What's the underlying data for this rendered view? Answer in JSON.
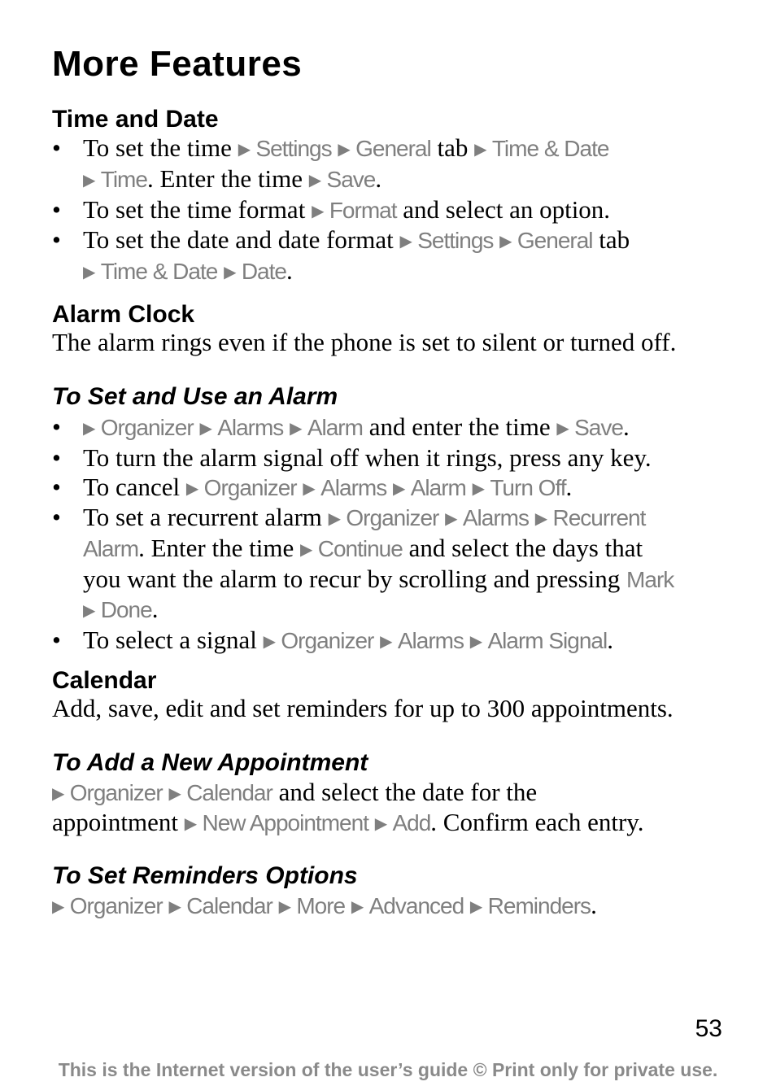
{
  "title": "More Features",
  "sections": {
    "time_date": {
      "heading": "Time and Date",
      "bullets": [
        [
          {
            "t": "text",
            "v": "To set the time "
          },
          {
            "t": "arrow"
          },
          {
            "t": "menu",
            "v": "Settings"
          },
          {
            "t": "text",
            "v": " "
          },
          {
            "t": "arrow"
          },
          {
            "t": "menu",
            "v": "General"
          },
          {
            "t": "text",
            "v": " tab "
          },
          {
            "t": "arrow"
          },
          {
            "t": "menu",
            "v": "Time & Date"
          },
          {
            "t": "br"
          },
          {
            "t": "arrow"
          },
          {
            "t": "menu",
            "v": "Time"
          },
          {
            "t": "text",
            "v": ". Enter the time "
          },
          {
            "t": "arrow"
          },
          {
            "t": "menu",
            "v": "Save"
          },
          {
            "t": "text",
            "v": "."
          }
        ],
        [
          {
            "t": "text",
            "v": "To set the time format "
          },
          {
            "t": "arrow"
          },
          {
            "t": "menu",
            "v": "Format"
          },
          {
            "t": "text",
            "v": " and select an option."
          }
        ],
        [
          {
            "t": "text",
            "v": "To set the date and date format "
          },
          {
            "t": "arrow"
          },
          {
            "t": "menu",
            "v": "Settings"
          },
          {
            "t": "text",
            "v": " "
          },
          {
            "t": "arrow"
          },
          {
            "t": "menu",
            "v": "General"
          },
          {
            "t": "text",
            "v": " tab"
          },
          {
            "t": "br"
          },
          {
            "t": "arrow"
          },
          {
            "t": "menu",
            "v": "Time & Date"
          },
          {
            "t": "text",
            "v": " "
          },
          {
            "t": "arrow"
          },
          {
            "t": "menu",
            "v": "Date"
          },
          {
            "t": "text",
            "v": "."
          }
        ]
      ]
    },
    "alarm_clock": {
      "heading": "Alarm Clock",
      "intro": "The alarm rings even if the phone is set to silent or turned off.",
      "subheading": "To Set and Use an Alarm",
      "bullets": [
        [
          {
            "t": "arrow"
          },
          {
            "t": "menu",
            "v": "Organizer"
          },
          {
            "t": "text",
            "v": " "
          },
          {
            "t": "arrow"
          },
          {
            "t": "menu",
            "v": "Alarms"
          },
          {
            "t": "text",
            "v": " "
          },
          {
            "t": "arrow"
          },
          {
            "t": "menu",
            "v": "Alarm"
          },
          {
            "t": "text",
            "v": " and enter the time "
          },
          {
            "t": "arrow"
          },
          {
            "t": "menu",
            "v": "Save"
          },
          {
            "t": "text",
            "v": "."
          }
        ],
        [
          {
            "t": "text",
            "v": "To turn the alarm signal off when it rings, press any key."
          }
        ],
        [
          {
            "t": "text",
            "v": "To cancel "
          },
          {
            "t": "arrow"
          },
          {
            "t": "menu",
            "v": "Organizer"
          },
          {
            "t": "text",
            "v": " "
          },
          {
            "t": "arrow"
          },
          {
            "t": "menu",
            "v": "Alarms"
          },
          {
            "t": "text",
            "v": " "
          },
          {
            "t": "arrow"
          },
          {
            "t": "menu",
            "v": "Alarm"
          },
          {
            "t": "text",
            "v": " "
          },
          {
            "t": "arrow"
          },
          {
            "t": "menu",
            "v": "Turn Off"
          },
          {
            "t": "text",
            "v": "."
          }
        ],
        [
          {
            "t": "text",
            "v": "To set a recurrent alarm "
          },
          {
            "t": "arrow"
          },
          {
            "t": "menu",
            "v": "Organizer"
          },
          {
            "t": "text",
            "v": " "
          },
          {
            "t": "arrow"
          },
          {
            "t": "menu",
            "v": "Alarms"
          },
          {
            "t": "text",
            "v": " "
          },
          {
            "t": "arrow"
          },
          {
            "t": "menu",
            "v": "Recurrent"
          },
          {
            "t": "br"
          },
          {
            "t": "menu",
            "v": "Alarm"
          },
          {
            "t": "text",
            "v": ". Enter the time "
          },
          {
            "t": "arrow"
          },
          {
            "t": "menu",
            "v": "Continue"
          },
          {
            "t": "text",
            "v": " and select the days that"
          },
          {
            "t": "br"
          },
          {
            "t": "text",
            "v": "you want the alarm to recur by scrolling and pressing "
          },
          {
            "t": "menu",
            "v": "Mark"
          },
          {
            "t": "br"
          },
          {
            "t": "arrow"
          },
          {
            "t": "menu",
            "v": "Done"
          },
          {
            "t": "text",
            "v": "."
          }
        ],
        [
          {
            "t": "text",
            "v": "To select a signal "
          },
          {
            "t": "arrow"
          },
          {
            "t": "menu",
            "v": "Organizer"
          },
          {
            "t": "text",
            "v": " "
          },
          {
            "t": "arrow"
          },
          {
            "t": "menu",
            "v": "Alarms"
          },
          {
            "t": "text",
            "v": " "
          },
          {
            "t": "arrow"
          },
          {
            "t": "menu",
            "v": "Alarm Signal"
          },
          {
            "t": "text",
            "v": "."
          }
        ]
      ]
    },
    "calendar": {
      "heading": "Calendar",
      "intro": "Add, save, edit and set reminders for up to 300 appointments.",
      "add_heading": "To Add a New Appointment",
      "add_body": [
        {
          "t": "arrow"
        },
        {
          "t": "menu",
          "v": "Organizer"
        },
        {
          "t": "text",
          "v": " "
        },
        {
          "t": "arrow"
        },
        {
          "t": "menu",
          "v": "Calendar"
        },
        {
          "t": "text",
          "v": " and select the date for the"
        },
        {
          "t": "br"
        },
        {
          "t": "text",
          "v": "appointment "
        },
        {
          "t": "arrow"
        },
        {
          "t": "menu",
          "v": "New Appointment"
        },
        {
          "t": "text",
          "v": " "
        },
        {
          "t": "arrow"
        },
        {
          "t": "menu",
          "v": "Add"
        },
        {
          "t": "text",
          "v": ". Confirm each entry."
        }
      ],
      "reminders_heading": "To Set Reminders Options",
      "reminders_body": [
        {
          "t": "arrow"
        },
        {
          "t": "menu",
          "v": "Organizer"
        },
        {
          "t": "text",
          "v": " "
        },
        {
          "t": "arrow"
        },
        {
          "t": "menu",
          "v": "Calendar"
        },
        {
          "t": "text",
          "v": " "
        },
        {
          "t": "arrow"
        },
        {
          "t": "menu",
          "v": "More"
        },
        {
          "t": "text",
          "v": " "
        },
        {
          "t": "arrow"
        },
        {
          "t": "menu",
          "v": "Advanced"
        },
        {
          "t": "text",
          "v": " "
        },
        {
          "t": "arrow"
        },
        {
          "t": "menu",
          "v": "Reminders"
        },
        {
          "t": "text",
          "v": "."
        }
      ]
    }
  },
  "icons": {
    "arrow": "▶ (arrow-right-icon)",
    "bullet": "•"
  },
  "colors": {
    "menu_text": "#7f7f7f",
    "body_text": "#000000",
    "footer_text": "#8a8a8a"
  },
  "page_number": "53",
  "footer": "This is the Internet version of the user’s guide © Print only for private use."
}
